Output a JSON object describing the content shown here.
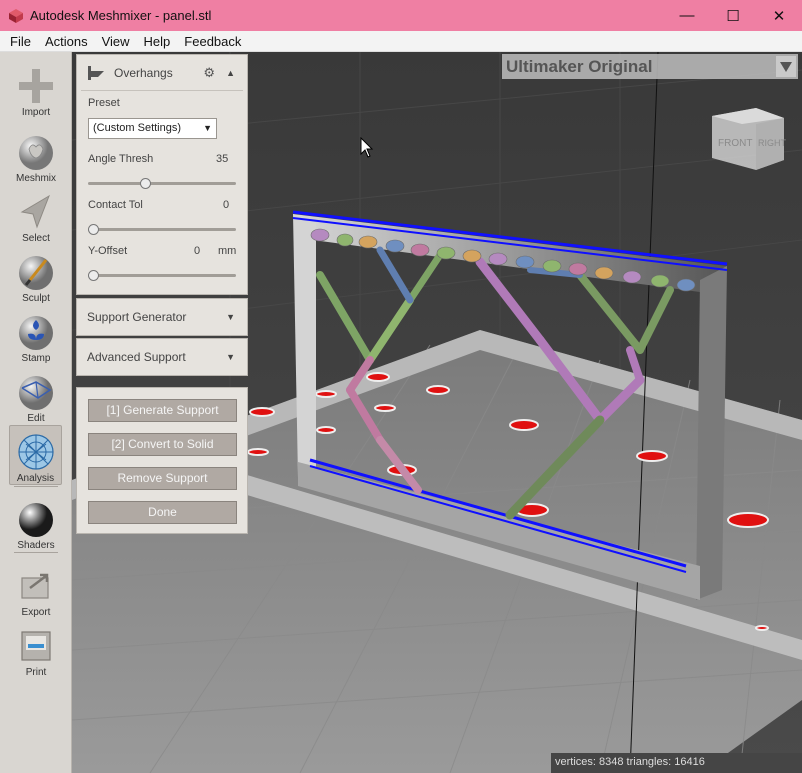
{
  "window": {
    "title": "Autodesk Meshmixer - panel.stl",
    "minimize": "—",
    "maximize": "☐",
    "close": "✕"
  },
  "menu": [
    "File",
    "Actions",
    "View",
    "Help",
    "Feedback"
  ],
  "tools": [
    {
      "label": "Import",
      "icon": "plus-icon"
    },
    {
      "label": "Meshmix",
      "icon": "bunny-icon"
    },
    {
      "label": "Select",
      "icon": "arrow-icon"
    },
    {
      "label": "Sculpt",
      "icon": "brush-icon"
    },
    {
      "label": "Stamp",
      "icon": "stamp-icon"
    },
    {
      "label": "Edit",
      "icon": "edit-icon"
    },
    {
      "label": "Analysis",
      "icon": "analysis-icon",
      "active": true
    },
    {
      "label": "Shaders",
      "icon": "sphere-icon"
    },
    {
      "label": "Export",
      "icon": "export-icon"
    },
    {
      "label": "Print",
      "icon": "printer-icon"
    }
  ],
  "overhangs": {
    "title": "Overhangs",
    "preset_label": "Preset",
    "preset_value": "(Custom Settings)",
    "angle_label": "Angle Thresh",
    "angle_value": "35",
    "angle_fraction": 0.38,
    "contact_label": "Contact Tol",
    "contact_value": "0",
    "contact_fraction": 0,
    "yoffset_label": "Y-Offset",
    "yoffset_value": "0",
    "yoffset_unit": "mm",
    "yoffset_fraction": 0
  },
  "support_generator": {
    "title": "Support Generator"
  },
  "advanced_support": {
    "title": "Advanced Support"
  },
  "actions": {
    "generate": "[1] Generate Support",
    "convert": "[2] Convert to Solid",
    "remove": "Remove Support",
    "done": "Done"
  },
  "printer": {
    "name": "Ultimaker Original"
  },
  "viewcube": {
    "front": "FRONT",
    "right": "RIGHT"
  },
  "status": "vertices: 8348 triangles: 16416",
  "colors": {
    "titlebar": "#ef7fa3",
    "toolbar": "#d9d6d1",
    "panel": "#e6e3de",
    "button": "#b0a9a3",
    "edge_highlight": "#1010ff",
    "overhang": "#e01010"
  }
}
